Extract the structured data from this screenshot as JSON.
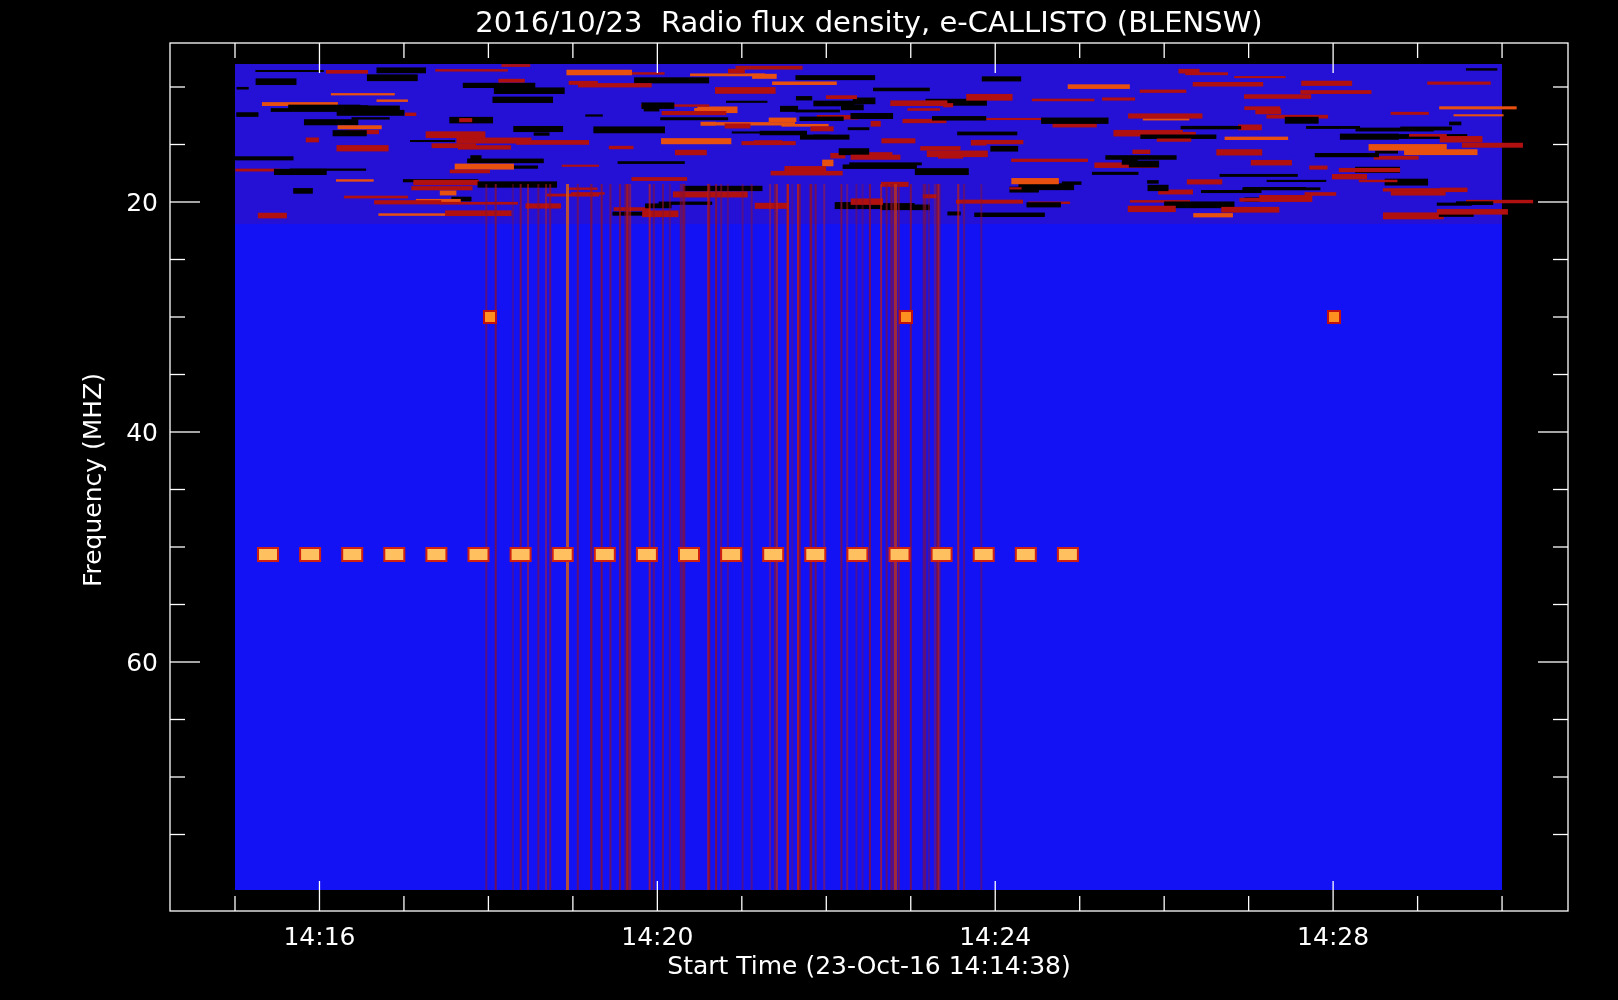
{
  "title": "2016/10/23  Radio flux density, e-CALLISTO (BLENSW)",
  "y_axis": {
    "label": "Frequency (MHZ)",
    "ticks": [
      "20",
      "40",
      "60"
    ]
  },
  "x_axis": {
    "label": "Start Time (23-Oct-16 14:14:38)",
    "ticks": [
      "14:16",
      "14:20",
      "14:24",
      "14:28"
    ]
  }
}
